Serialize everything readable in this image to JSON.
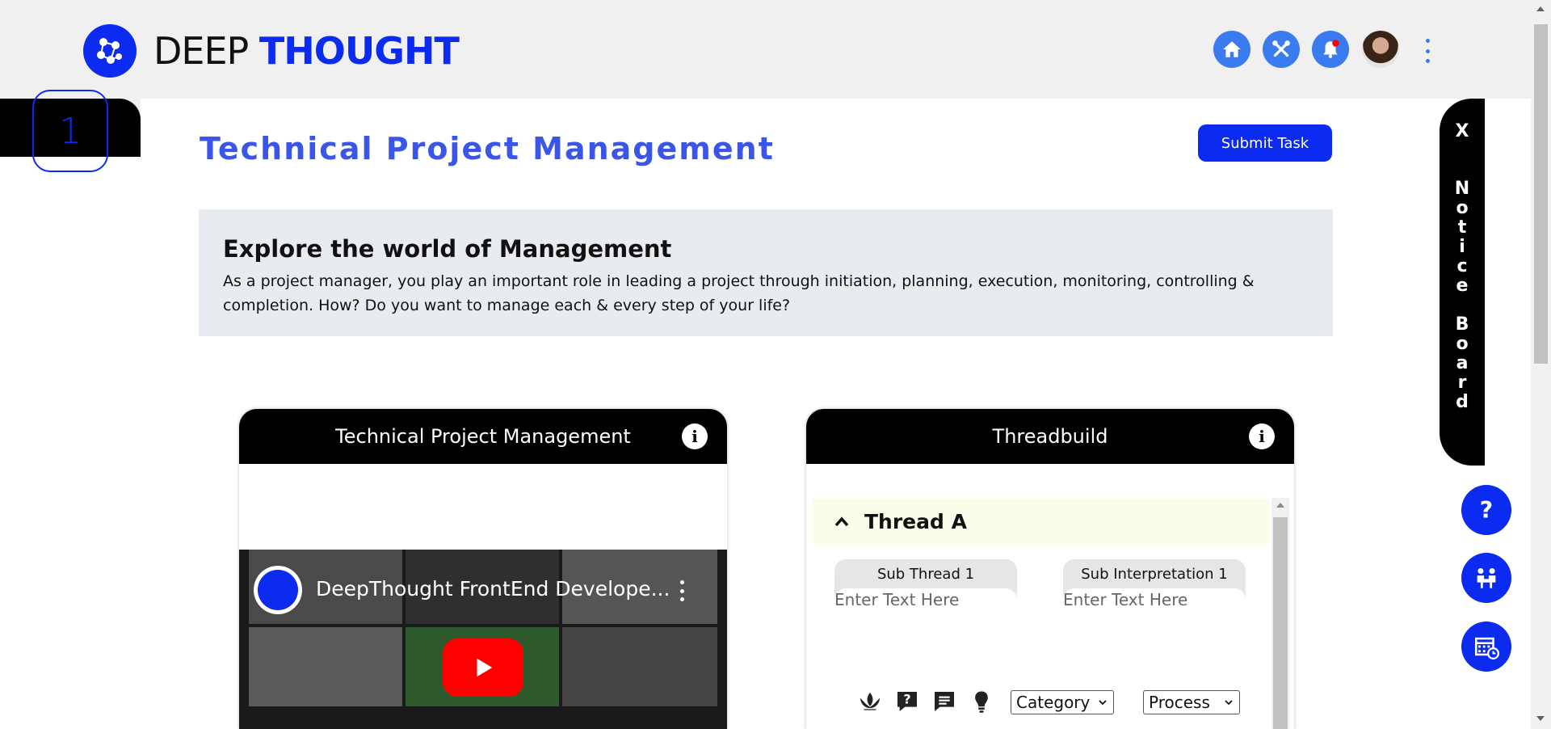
{
  "header": {
    "brand_part1": "DEEP",
    "brand_part2": "THOUGHT",
    "icons": [
      "home-icon",
      "tools-icon",
      "bell-icon",
      "avatar",
      "more-vertical-icon"
    ],
    "notification_dot_color": "#ff0000"
  },
  "sidebar": {
    "step_number": "1"
  },
  "main": {
    "title": "Technical Project Management",
    "submit_label": "Submit Task",
    "banner": {
      "heading": "Explore the world of Management",
      "text": "As a project manager, you play an important role in leading a project through initiation, planning, execution, monitoring, controlling & completion. How? Do you want to manage each & every step of your life?"
    }
  },
  "video_card": {
    "title": "Technical Project Management",
    "video_title": "DeepThought FrontEnd Develope..."
  },
  "thread_card": {
    "title": "Threadbuild",
    "thread_label": "Thread A",
    "sub_thread_label": "Sub Thread 1",
    "sub_interpretation_label": "Sub Interpretation 1",
    "placeholder": "Enter Text Here",
    "category_value": "Category",
    "process_value": "Process"
  },
  "notice_board": {
    "close_label": "X",
    "label": "Notice Board"
  },
  "colors": {
    "brand": "#0b2bf0",
    "title": "#3a55e8",
    "header_icon": "#3a7bf0"
  }
}
